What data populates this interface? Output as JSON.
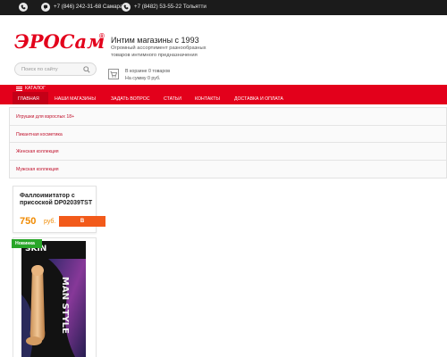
{
  "topbar": {
    "phone1": "+7 (846) 242-31-68 Самара",
    "phone2": "+7 (8482) 53-55-22 Тольятти"
  },
  "header": {
    "logo": "ЭРОСам",
    "logo_mark": "®",
    "tagline": "Интим магазины с 1993",
    "description": "Огромный ассортимент разнообразных товаров интимного предназначения",
    "search_placeholder": "Поиск по сайту",
    "cart_line1": "В корзине 0 товаров",
    "cart_line2": "На сумму 0 руб."
  },
  "nav": {
    "catalog": "КАТАЛОГ",
    "items": [
      "ГЛАВНАЯ",
      "НАШИ МАГАЗИНЫ",
      "ЗАДАТЬ ВОПРОС",
      "СТАТЬИ",
      "КОНТАКТЫ",
      "ДОСТАВКА И ОПЛАТА"
    ]
  },
  "categories": [
    "Игрушки для взрослых 18+",
    "Пикантная косметика",
    "Женская коллекция",
    "Мужская коллекция"
  ],
  "products": [
    {
      "name": "Фаллоимитатор с присоской DP02039TST",
      "price": "750",
      "currency": "руб.",
      "button": "В"
    },
    {
      "badge": "Новинка",
      "image_text_top": "SKIN",
      "image_text_side": "MAN STYLE"
    }
  ],
  "colors": {
    "brand_red": "#e3001b",
    "price_orange": "#f08a00",
    "buy_button": "#f25a1a",
    "badge_green": "#29a629"
  }
}
